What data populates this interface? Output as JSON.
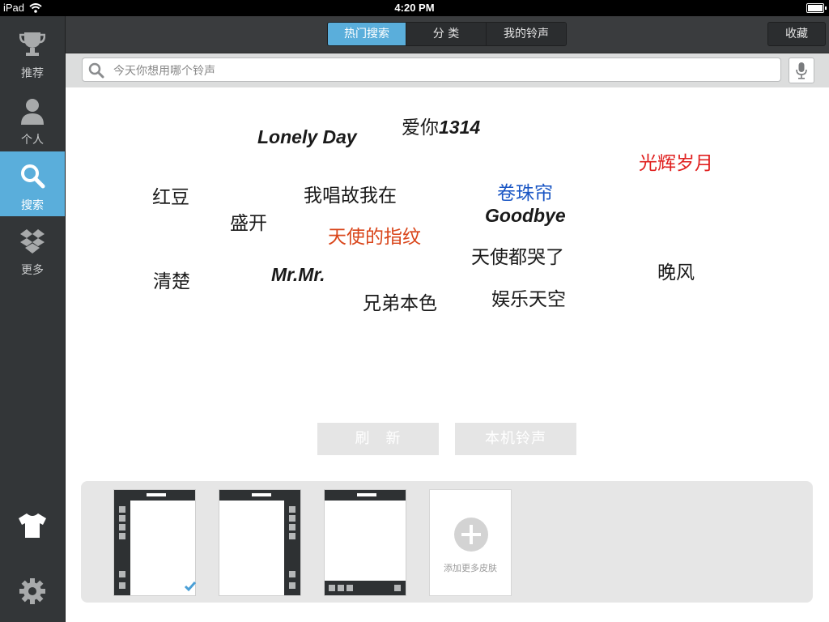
{
  "status": {
    "device": "iPad",
    "time": "4:20 PM"
  },
  "sidebar": {
    "items": [
      {
        "label": "推荐",
        "icon": "trophy-icon"
      },
      {
        "label": "个人",
        "icon": "person-icon"
      },
      {
        "label": "搜索",
        "icon": "search-icon",
        "active": true
      },
      {
        "label": "更多",
        "icon": "dropbox-icon"
      }
    ],
    "bottom_icons": [
      "tshirt-icon",
      "gear-icon"
    ]
  },
  "topbar": {
    "tabs": [
      {
        "label": "热门搜索",
        "active": true
      },
      {
        "label": "分 类"
      },
      {
        "label": "我的铃声"
      }
    ],
    "favorites_label": "收藏"
  },
  "search": {
    "placeholder": "今天你想用哪个铃声",
    "mic_icon": "microphone-icon"
  },
  "hot_tags": [
    {
      "text": "爱你",
      "text2": "1314"
    },
    {
      "text": "Lonely Day"
    },
    {
      "text": "光辉岁月",
      "color": "#e0201f"
    },
    {
      "text": "红豆"
    },
    {
      "text": "我唱故我在"
    },
    {
      "text": "卷珠帘",
      "color": "#1a56c4"
    },
    {
      "text": "盛开"
    },
    {
      "text": "Goodbye"
    },
    {
      "text": "天使的指纹",
      "color": "#d9451a"
    },
    {
      "text": "天使都哭了"
    },
    {
      "text": "清楚"
    },
    {
      "text": "Mr.Mr."
    },
    {
      "text": "晚风"
    },
    {
      "text": "兄弟本色"
    },
    {
      "text": "娱乐天空"
    }
  ],
  "buttons": {
    "refresh": "刷　新",
    "local": "本机铃声"
  },
  "skins": {
    "add_label": "添加更多皮肤",
    "check_icon": "checkmark-icon"
  }
}
